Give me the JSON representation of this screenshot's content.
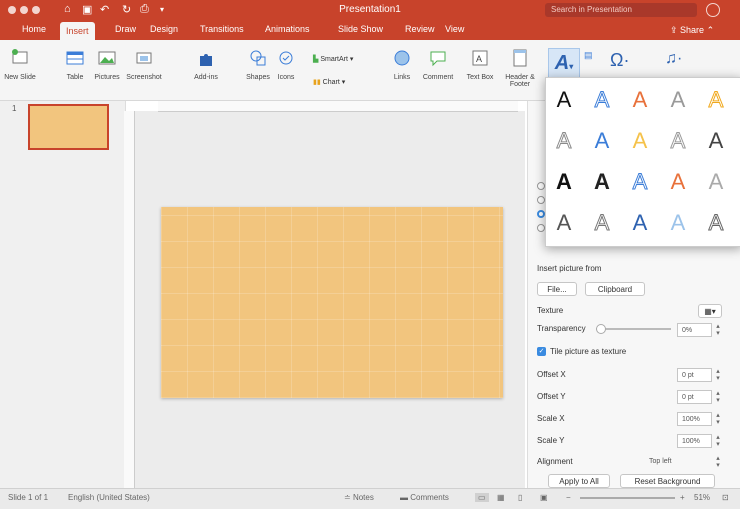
{
  "window": {
    "title": "Presentation1",
    "search_placeholder": "Search in Presentation"
  },
  "tabs": [
    {
      "label": "Home"
    },
    {
      "label": "Insert"
    },
    {
      "label": "Draw"
    },
    {
      "label": "Design"
    },
    {
      "label": "Transitions"
    },
    {
      "label": "Animations"
    },
    {
      "label": "Slide Show"
    },
    {
      "label": "Review"
    },
    {
      "label": "View"
    }
  ],
  "share_label": "Share",
  "ribbon": {
    "new_slide": "New Slide",
    "table": "Table",
    "pictures": "Pictures",
    "screenshot": "Screenshot",
    "addins": "Add-ins",
    "shapes": "Shapes",
    "icons": "Icons",
    "smartart": "SmartArt",
    "chart": "Chart",
    "links": "Links",
    "comment": "Comment",
    "textbox": "Text Box",
    "header_footer": "Header & Footer"
  },
  "thumbnail": {
    "number": "1"
  },
  "pane": {
    "insert_from": "Insert picture from",
    "file_button": "File...",
    "clipboard_button": "Clipboard",
    "texture_label": "Texture",
    "transparency_label": "Transparency",
    "transparency_value": "0%",
    "tile_label": "Tile picture as texture",
    "offset_x_label": "Offset X",
    "offset_x_value": "0 pt",
    "offset_y_label": "Offset Y",
    "offset_y_value": "0 pt",
    "scale_x_label": "Scale X",
    "scale_x_value": "100%",
    "scale_y_label": "Scale Y",
    "scale_y_value": "100%",
    "alignment_label": "Alignment",
    "alignment_value": "Top left",
    "apply_all": "Apply to All",
    "reset_bg": "Reset Background"
  },
  "wordart": {
    "rows": [
      [
        "A",
        "A",
        "A",
        "A",
        "A"
      ],
      [
        "A",
        "A",
        "A",
        "A",
        "A"
      ],
      [
        "A",
        "A",
        "A",
        "A",
        "A"
      ],
      [
        "A",
        "A",
        "A",
        "A",
        "A"
      ]
    ],
    "colors": [
      [
        "#111111",
        "#3b7dd8",
        "#e8713b",
        "#9a9a9a",
        "#f0a81c"
      ],
      [
        "#8a8a8a",
        "#3b7dd8",
        "#f5c24a",
        "#9a9a9a",
        "#444444"
      ],
      [
        "#111111",
        "#222222",
        "#3b7dd8",
        "#e8713b",
        "#aaaaaa"
      ],
      [
        "#555555",
        "#777777",
        "#2e62b0",
        "#9cc3ea",
        "#666666"
      ]
    ]
  },
  "status": {
    "slide": "Slide 1 of 1",
    "language": "English (United States)",
    "notes": "Notes",
    "comments": "Comments",
    "zoom": "51%"
  },
  "colors": {
    "accent": "#c8432b",
    "selection": "#3a8be0"
  }
}
